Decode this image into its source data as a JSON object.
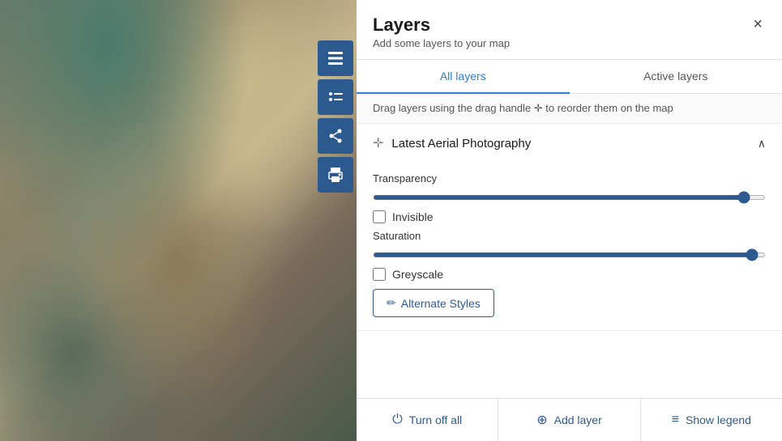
{
  "panel": {
    "title": "Layers",
    "subtitle": "Add some layers to your map",
    "close_label": "×"
  },
  "tabs": [
    {
      "id": "all-layers",
      "label": "All layers",
      "active": true
    },
    {
      "id": "active-layers",
      "label": "Active layers",
      "active": false
    }
  ],
  "drag_hint": "Drag layers using the drag handle ✛ to reorder them on the map",
  "layers": [
    {
      "id": "latest-aerial",
      "name": "Latest Aerial Photography",
      "expanded": true,
      "transparency": {
        "label": "Transparency",
        "value": 96,
        "max": 100
      },
      "invisible": {
        "label": "Invisible",
        "checked": false
      },
      "saturation": {
        "label": "Saturation",
        "value": 98,
        "max": 100
      },
      "greyscale": {
        "label": "Greyscale",
        "checked": false
      },
      "alternate_styles_label": "Alternate Styles"
    }
  ],
  "footer": {
    "turn_off_all": "Turn off all",
    "add_layer": "Add layer",
    "show_legend": "Show legend"
  },
  "sidebar": {
    "tools": [
      {
        "id": "layers",
        "icon": "⊞",
        "label": "layers-tool"
      },
      {
        "id": "legend",
        "icon": "≡",
        "label": "legend-tool"
      },
      {
        "id": "share",
        "icon": "⬡",
        "label": "share-tool"
      },
      {
        "id": "print",
        "icon": "⊡",
        "label": "print-tool"
      }
    ]
  },
  "colors": {
    "accent": "#2d5a8e",
    "tab_active": "#2d7dd2"
  }
}
